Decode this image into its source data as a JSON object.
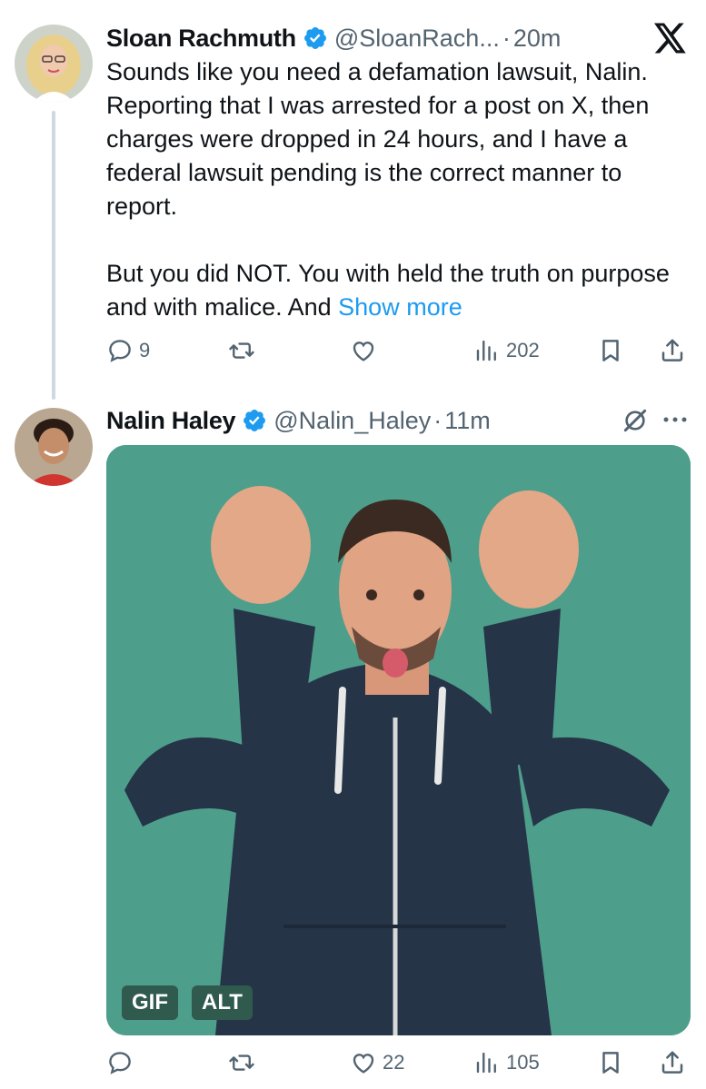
{
  "tweets": [
    {
      "display_name": "Sloan Rachmuth",
      "handle": "@SloanRach...",
      "separator": "·",
      "time": "20m",
      "text_p1": "Sounds like you need a defamation lawsuit, Nalin. Reporting that I was arrested for a post on X, then charges were dropped in 24 hours, and I have a federal lawsuit pending is the correct manner to report.",
      "text_p2": "But you did NOT. You with held the truth on purpose and with malice. And ",
      "show_more": "Show more",
      "replies": "9",
      "reposts": "",
      "likes": "",
      "views": "202"
    },
    {
      "display_name": "Nalin Haley",
      "handle": "@Nalin_Haley",
      "separator": "·",
      "time": "11m",
      "media_type": "animated-gif",
      "gif_badge": "GIF",
      "alt_badge": "ALT",
      "replies": "",
      "reposts": "",
      "likes": "22",
      "views": "105"
    }
  ],
  "icons": {
    "brand": "x-logo-icon",
    "verified": "verified-badge-icon",
    "reply": "reply-icon",
    "repost": "repost-icon",
    "like": "heart-icon",
    "views": "views-icon",
    "bookmark": "bookmark-icon",
    "share": "share-icon",
    "grok": "grok-icon",
    "more": "more-icon"
  },
  "colors": {
    "text": "#0f1419",
    "secondary": "#536471",
    "link": "#1d9bf0",
    "thread_line": "#cfd9de",
    "media_bg": "#4e9e8c",
    "badge_bg": "#2f5a4d"
  }
}
